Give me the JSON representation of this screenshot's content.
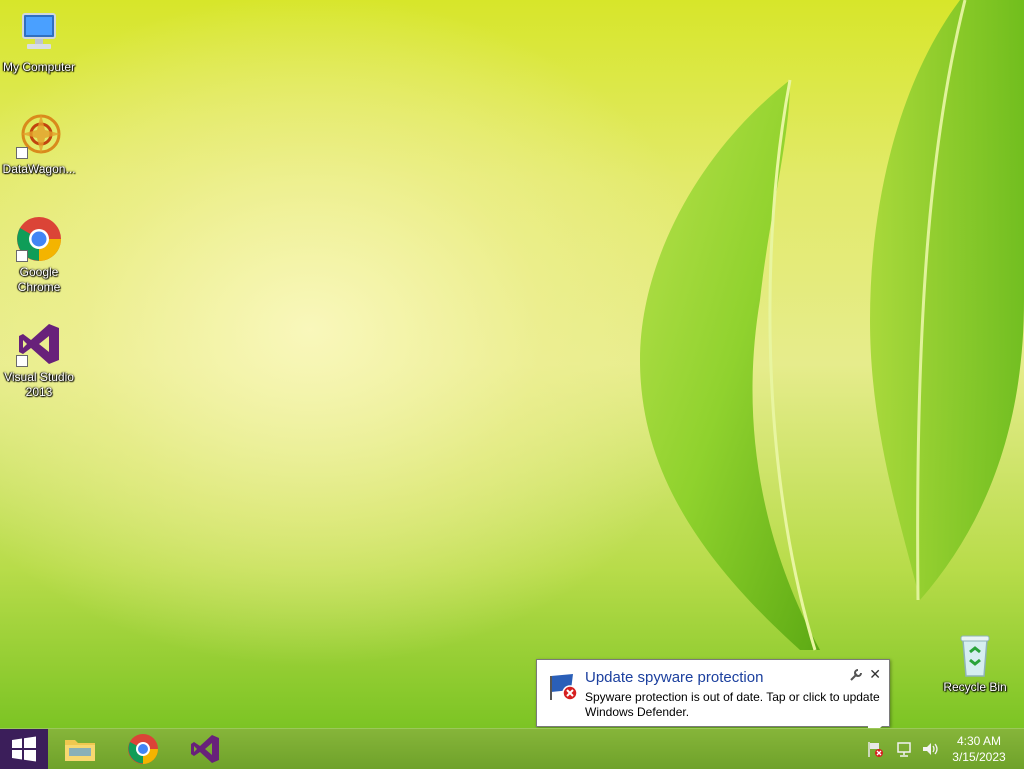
{
  "desktop": {
    "icons": [
      {
        "label": "My Computer",
        "icon": "computer-icon"
      },
      {
        "label": "DataWagon...",
        "icon": "datawagon-app-icon"
      },
      {
        "label": "Google Chrome",
        "icon": "chrome-icon"
      },
      {
        "label": "Visual Studio 2013",
        "icon": "visual-studio-icon"
      },
      {
        "label": "Recycle Bin",
        "icon": "recycle-bin-icon"
      }
    ]
  },
  "taskbar": {
    "start_icon": "windows-logo-icon",
    "pinned": [
      {
        "name": "File Explorer",
        "icon": "folder-icon"
      },
      {
        "name": "Google Chrome",
        "icon": "chrome-icon"
      },
      {
        "name": "Visual Studio",
        "icon": "visual-studio-icon"
      }
    ],
    "tray": {
      "icons": [
        "action-center-flag-icon",
        "network-icon",
        "volume-icon"
      ],
      "time": "4:30 AM",
      "date": "3/15/2023"
    }
  },
  "notification": {
    "title": "Update spyware protection",
    "message": "Spyware protection is out of date. Tap or click to update Windows Defender.",
    "icon": "defender-warning-icon",
    "options_icon": "wrench-icon",
    "close_glyph": "✕"
  },
  "colors": {
    "start_bg": "#3b1e5a",
    "taskbar_bg": "#7aac30",
    "balloon_title": "#1b3f9e"
  }
}
